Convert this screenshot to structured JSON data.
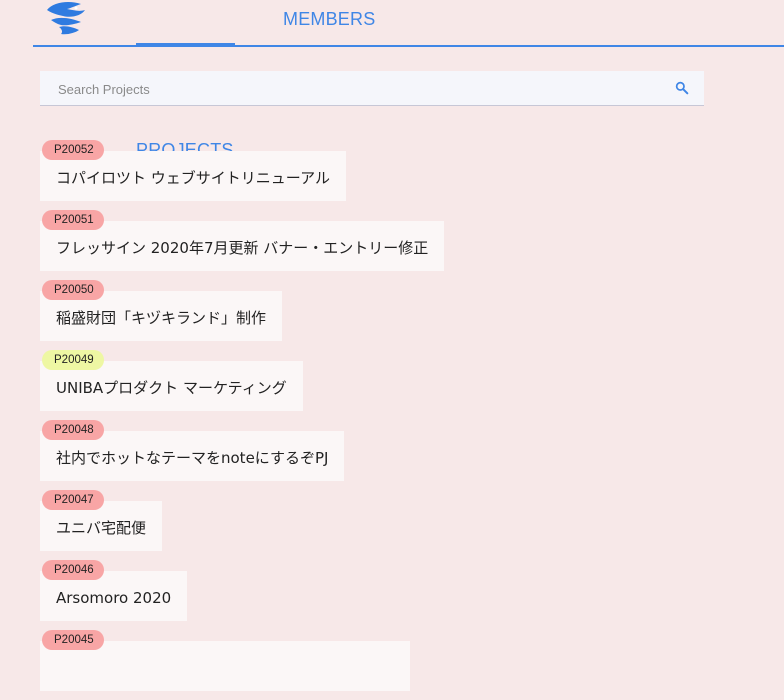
{
  "header": {
    "logo_icon": "blue-fish-logo-icon",
    "tabs": [
      {
        "label": "PROJECTS",
        "active": true
      },
      {
        "label": "MEMBERS",
        "active": false
      }
    ],
    "accent_color": "#3f86e6"
  },
  "search": {
    "placeholder": "Search Projects",
    "icon": "search-icon"
  },
  "projects": [
    {
      "id": "P20052",
      "title": "コパイロツト ウェブサイトリニューアル",
      "badge_color": "#f8a5a5"
    },
    {
      "id": "P20051",
      "title": "フレッサイン 2020年7月更新 バナー・エントリー修正",
      "badge_color": "#f8a5a5"
    },
    {
      "id": "P20050",
      "title": "稲盛財団「キヅキランド」制作",
      "badge_color": "#f8a5a5"
    },
    {
      "id": "P20049",
      "title": "UNIBAプロダクト マーケティング",
      "badge_color": "#eef7a3"
    },
    {
      "id": "P20048",
      "title": "社内でホットなテーマをnoteにするぞPJ",
      "badge_color": "#f8a5a5"
    },
    {
      "id": "P20047",
      "title": "ユニバ宅配便",
      "badge_color": "#f8a5a5"
    },
    {
      "id": "P20046",
      "title": "Arsomoro 2020",
      "badge_color": "#f8a5a5"
    },
    {
      "id": "P20045",
      "title": "",
      "badge_color": "#f8a5a5"
    }
  ]
}
